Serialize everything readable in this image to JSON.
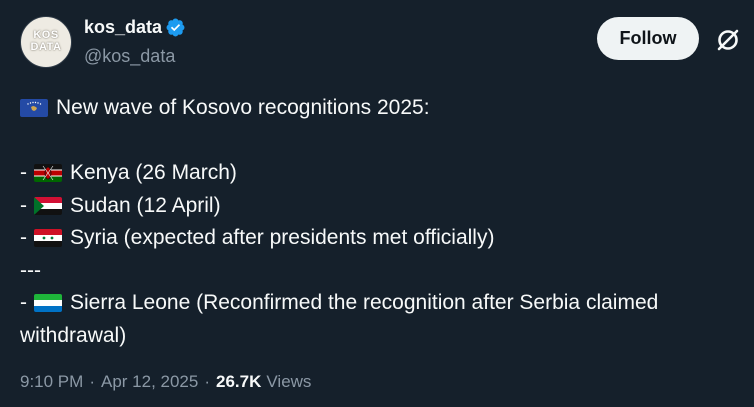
{
  "user": {
    "avatar_text_line1": "KOS",
    "avatar_text_line2": "DATA",
    "name": "kos_data",
    "handle": "@kos_data",
    "verified": true
  },
  "actions": {
    "follow_label": "Follow"
  },
  "post": {
    "intro": "New wave of Kosovo recognitions 2025:",
    "dash": "-",
    "items": [
      {
        "flag": "kenya-flag",
        "text": "Kenya (26 March)"
      },
      {
        "flag": "sudan-flag",
        "text": "Sudan (12 April)"
      },
      {
        "flag": "syria-flag",
        "text": "Syria (expected after presidents met officially)"
      }
    ],
    "separator": "---",
    "last_item": {
      "flag": "sierra-leone-flag",
      "text_line1": "Sierra Leone (Reconfirmed the recognition after Serbia claimed",
      "text_line2": "withdrawal)"
    }
  },
  "meta": {
    "time": "9:10 PM",
    "date": "Apr 12, 2025",
    "dot": "·",
    "views_count": "26.7K",
    "views_label": "Views"
  },
  "colors": {
    "background": "#15202b",
    "text": "#f7f9f9",
    "secondary_text": "#8b98a5",
    "verified_blue": "#1d9bf0"
  }
}
